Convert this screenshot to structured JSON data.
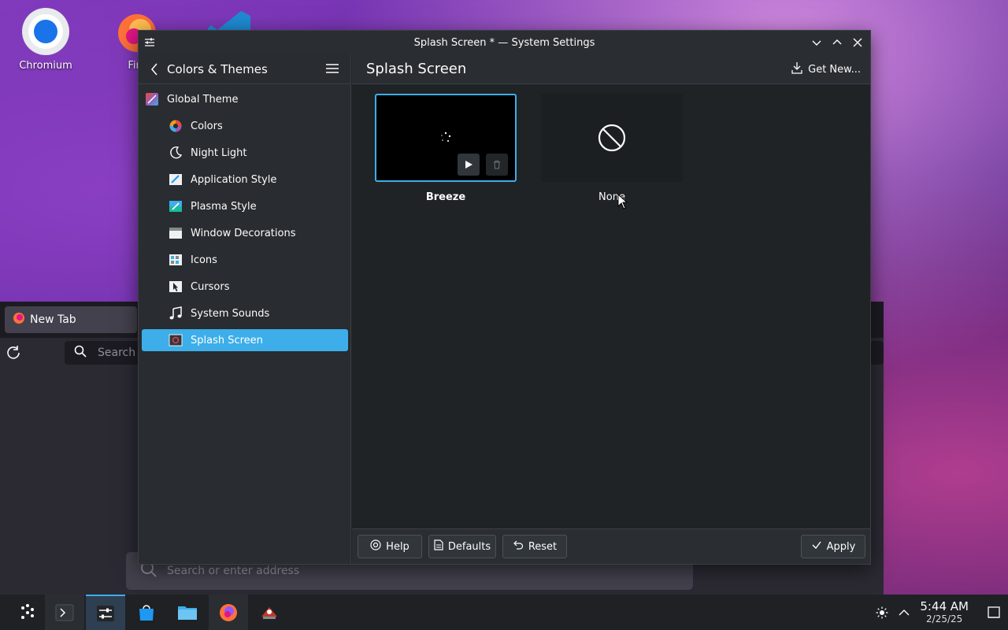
{
  "desktop": {
    "icons": [
      {
        "label": "Chromium",
        "icon": "chromium-icon"
      },
      {
        "label": "Fire",
        "icon": "firefox-icon"
      },
      {
        "label": "",
        "icon": "vscode-icon"
      }
    ]
  },
  "bg_browser": {
    "tab_label": "New Tab",
    "search_small": "Search",
    "search_big_placeholder": "Search or enter address"
  },
  "window": {
    "title": "Splash Screen * — System Settings",
    "sidebar": {
      "header": "Colors & Themes",
      "items": [
        {
          "label": "Global Theme",
          "icon": "global-theme-icon"
        },
        {
          "label": "Colors",
          "icon": "colors-icon"
        },
        {
          "label": "Night Light",
          "icon": "night-light-icon"
        },
        {
          "label": "Application Style",
          "icon": "application-style-icon"
        },
        {
          "label": "Plasma Style",
          "icon": "plasma-style-icon"
        },
        {
          "label": "Window Decorations",
          "icon": "window-decorations-icon"
        },
        {
          "label": "Icons",
          "icon": "icons-icon"
        },
        {
          "label": "Cursors",
          "icon": "cursors-icon"
        },
        {
          "label": "System Sounds",
          "icon": "system-sounds-icon"
        },
        {
          "label": "Splash Screen",
          "icon": "splash-screen-icon"
        }
      ],
      "selected": "Splash Screen"
    },
    "main": {
      "title": "Splash Screen",
      "get_new": "Get New...",
      "themes": [
        {
          "label": "Breeze",
          "selected": true
        },
        {
          "label": "None",
          "selected": false
        }
      ],
      "footer": {
        "help": "Help",
        "defaults": "Defaults",
        "reset": "Reset",
        "apply": "Apply"
      }
    }
  },
  "taskbar": {
    "time": "5:44 AM",
    "date": "2/25/25"
  },
  "colors": {
    "accent": "#3daee9",
    "window_bg": "#202326",
    "sidebar_bg": "#292c30"
  }
}
